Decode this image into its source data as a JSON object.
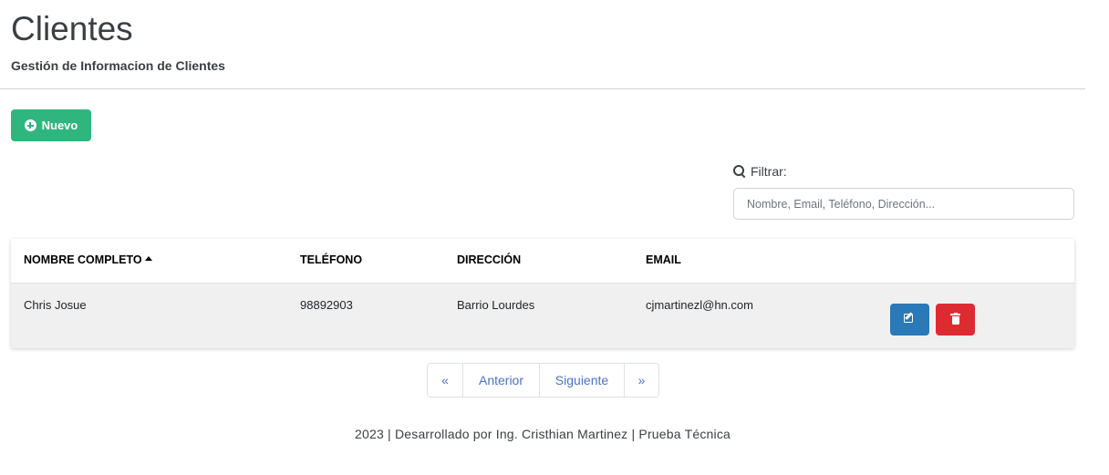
{
  "header": {
    "title": "Clientes",
    "subtitle": "Gestión de Informacion de Clientes"
  },
  "toolbar": {
    "new_label": "Nuevo",
    "new_icon": "plus-circle-icon"
  },
  "filter": {
    "label": "Filtrar:",
    "placeholder": "Nombre, Email, Teléfono, Dirección...",
    "value": "",
    "icon": "search-icon"
  },
  "table": {
    "columns": [
      "NOMBRE COMPLETO",
      "TELÉFONO",
      "DIRECCIÓN",
      "EMAIL"
    ],
    "sort": {
      "column": "NOMBRE COMPLETO",
      "direction": "asc"
    },
    "rows": [
      {
        "nombre": "Chris Josue",
        "telefono": "98892903",
        "direccion": "Barrio Lourdes",
        "email": "cjmartinezl@hn.com",
        "actions": [
          "edit-icon",
          "trash-icon"
        ]
      }
    ]
  },
  "pagination": {
    "first": "«",
    "prev": "Anterior",
    "next": "Siguiente",
    "last": "»"
  },
  "footer": {
    "text": "2023 | Desarrollado por Ing. Cristhian Martinez | Prueba Técnica"
  },
  "colors": {
    "success": "#2fb67f",
    "primary": "#2a79b8",
    "danger": "#de2b32",
    "link": "#4c72c9"
  }
}
